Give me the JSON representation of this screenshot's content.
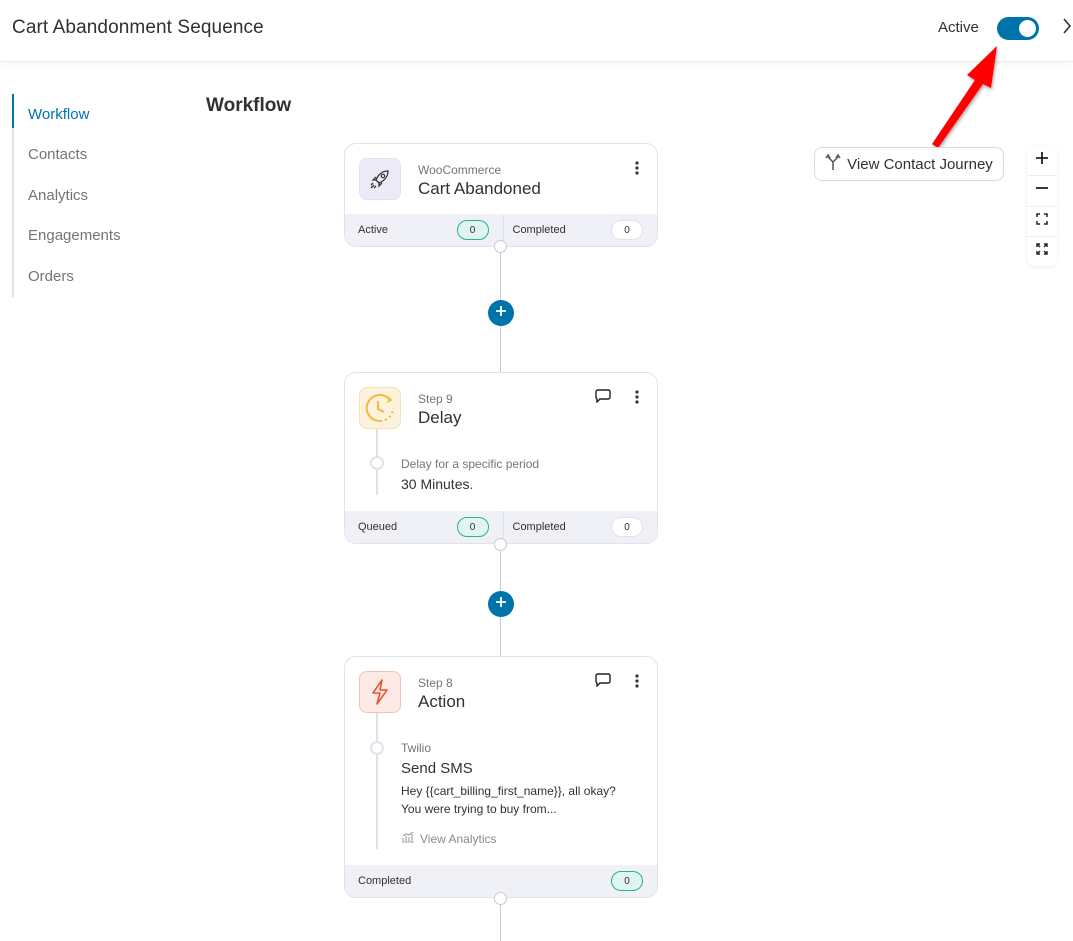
{
  "header": {
    "title": "Cart Abandonment Sequence",
    "status_label": "Active",
    "toggle_on": true,
    "next_icon": "chevron-right-icon"
  },
  "sidebar": {
    "items": [
      {
        "label": "Workflow",
        "active": true
      },
      {
        "label": "Contacts",
        "active": false
      },
      {
        "label": "Analytics",
        "active": false
      },
      {
        "label": "Engagements",
        "active": false
      },
      {
        "label": "Orders",
        "active": false
      }
    ]
  },
  "main": {
    "title": "Workflow",
    "view_contact_journey_label": "View Contact Journey",
    "zoom_controls": [
      "zoom-in",
      "zoom-out",
      "fit-to-screen",
      "fullscreen"
    ]
  },
  "nodes": {
    "trigger": {
      "icon": "rocket-icon",
      "subtitle": "WooCommerce",
      "title": "Cart Abandoned",
      "stats": [
        {
          "label": "Active",
          "value": "0"
        },
        {
          "label": "Completed",
          "value": "0"
        }
      ]
    },
    "delay": {
      "icon": "clock-icon",
      "subtitle": "Step 9",
      "title": "Delay",
      "detail_label": "Delay for a specific period",
      "detail_value": "30 Minutes.",
      "stats": [
        {
          "label": "Queued",
          "value": "0"
        },
        {
          "label": "Completed",
          "value": "0"
        }
      ]
    },
    "action": {
      "icon": "lightning-icon",
      "subtitle": "Step 8",
      "title": "Action",
      "integration": "Twilio",
      "action_name": "Send SMS",
      "message_line1": "Hey {{cart_billing_first_name}}, all okay?",
      "message_line2": "You were trying to buy from...",
      "analytics_link": "View Analytics",
      "stats": [
        {
          "label": "Completed",
          "value": "0"
        }
      ]
    }
  },
  "colors": {
    "accent": "#0073aa",
    "success_border": "#2ab28b",
    "success_bg": "#e0f5ef",
    "annotation_arrow": "#ff0000"
  }
}
